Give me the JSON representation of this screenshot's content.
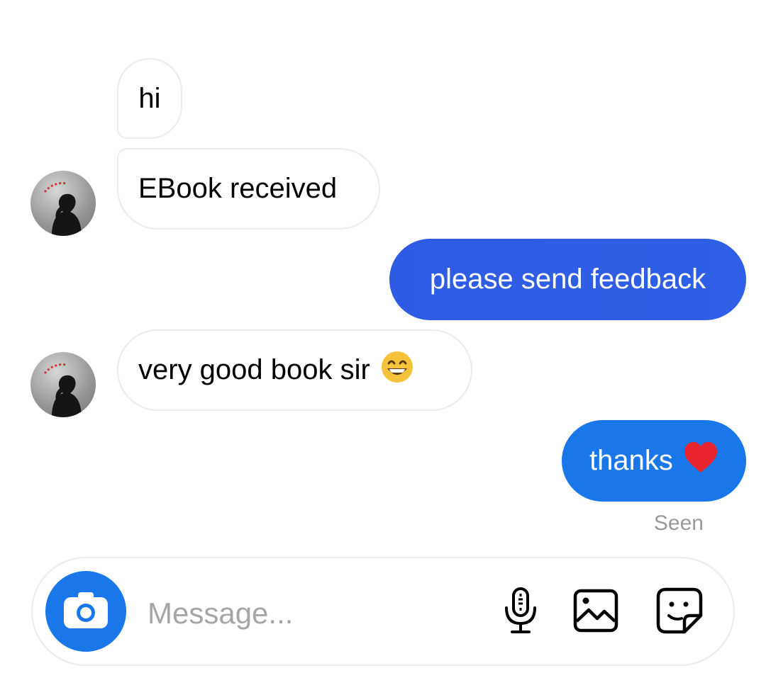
{
  "conversation": {
    "messages": [
      {
        "direction": "incoming",
        "text": "hi"
      },
      {
        "direction": "incoming",
        "text": "EBook received"
      },
      {
        "direction": "outgoing",
        "text": "please send feedback"
      },
      {
        "direction": "incoming",
        "text": "very good book sir",
        "emoji": "grinning-face-with-smiling-eyes"
      },
      {
        "direction": "outgoing",
        "text": "thanks",
        "emoji": "red-heart"
      }
    ],
    "status": "Seen",
    "avatar_icon": "contact-avatar-icon"
  },
  "composer": {
    "placeholder": "Message...",
    "value": "",
    "left_icon": "camera-icon",
    "tools": [
      "microphone-icon",
      "image-gallery-icon",
      "sticker-icon"
    ]
  },
  "colors": {
    "outgoing_bubble_start": "#2f5be4",
    "outgoing_bubble_end": "#1a77e9",
    "camera_button": "#1a77e9",
    "incoming_border": "#ececec",
    "seen_text": "#9a9a9a",
    "placeholder_text": "#a6a6a6",
    "heart": "#e8242e",
    "emoji_face": "#f5c33b"
  }
}
